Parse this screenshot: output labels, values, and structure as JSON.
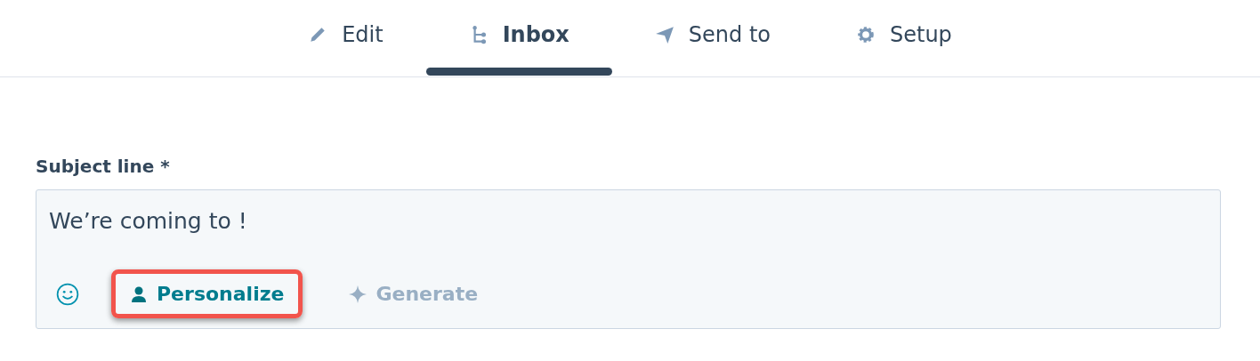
{
  "tabs": [
    {
      "label": "Edit",
      "kind": "edit",
      "selected": false
    },
    {
      "label": "Inbox",
      "kind": "inbox",
      "selected": true
    },
    {
      "label": "Send to",
      "kind": "send",
      "selected": false
    },
    {
      "label": "Setup",
      "kind": "setup",
      "selected": false
    }
  ],
  "subject": {
    "label": "Subject line *",
    "value": "We’re coming to !"
  },
  "actions": [
    {
      "kind": "emoji"
    },
    {
      "kind": "personalize",
      "label": "Personalize",
      "disabled": false,
      "highlighted": true
    },
    {
      "kind": "generate",
      "label": "Generate",
      "disabled": true,
      "highlighted": false
    }
  ]
}
